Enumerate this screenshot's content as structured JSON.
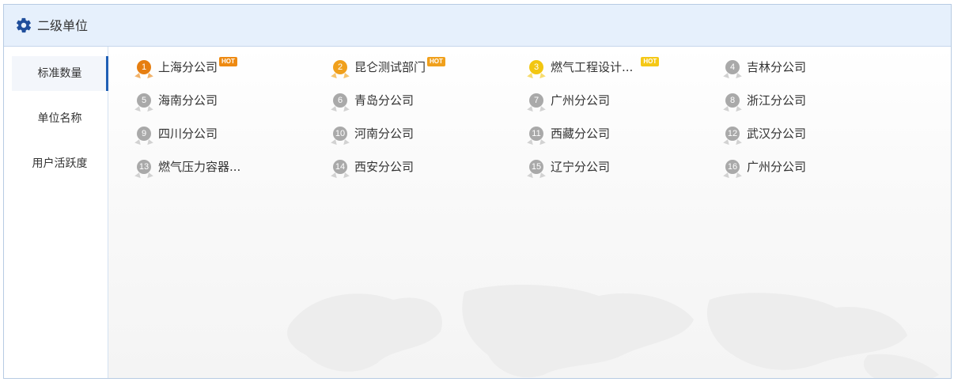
{
  "header": {
    "title": "二级单位",
    "icon": "gear-icon",
    "icon_color": "#1f4e9c"
  },
  "sidebar": {
    "items": [
      {
        "label": "标准数量",
        "active": true
      },
      {
        "label": "单位名称",
        "active": false
      },
      {
        "label": "用户活跃度",
        "active": false
      }
    ],
    "active_color": "#1f5fb5"
  },
  "ranking": {
    "hot_label": "HOT",
    "items": [
      {
        "rank": "1",
        "name": "上海分公司",
        "hot": true
      },
      {
        "rank": "2",
        "name": "昆仑测试部门",
        "hot": true
      },
      {
        "rank": "3",
        "name": "燃气工程设计...",
        "hot": true
      },
      {
        "rank": "4",
        "name": "吉林分公司",
        "hot": false
      },
      {
        "rank": "5",
        "name": "海南分公司",
        "hot": false
      },
      {
        "rank": "6",
        "name": "青岛分公司",
        "hot": false
      },
      {
        "rank": "7",
        "name": "广州分公司",
        "hot": false
      },
      {
        "rank": "8",
        "name": "浙江分公司",
        "hot": false
      },
      {
        "rank": "9",
        "name": "四川分公司",
        "hot": false
      },
      {
        "rank": "10",
        "name": "河南分公司",
        "hot": false
      },
      {
        "rank": "11",
        "name": "西藏分公司",
        "hot": false
      },
      {
        "rank": "12",
        "name": "武汉分公司",
        "hot": false
      },
      {
        "rank": "13",
        "name": "燃气压力容器...",
        "hot": false
      },
      {
        "rank": "14",
        "name": "西安分公司",
        "hot": false
      },
      {
        "rank": "15",
        "name": "辽宁分公司",
        "hot": false
      },
      {
        "rank": "16",
        "name": "广州分公司",
        "hot": false
      }
    ],
    "colors": {
      "rank1": "#e67e10",
      "rank2": "#f0a01c",
      "rank3": "#f2c611",
      "other": "#a9a9a9"
    },
    "hot_colors": [
      "#ee8a12",
      "#f0a01c",
      "#f5c816"
    ]
  }
}
